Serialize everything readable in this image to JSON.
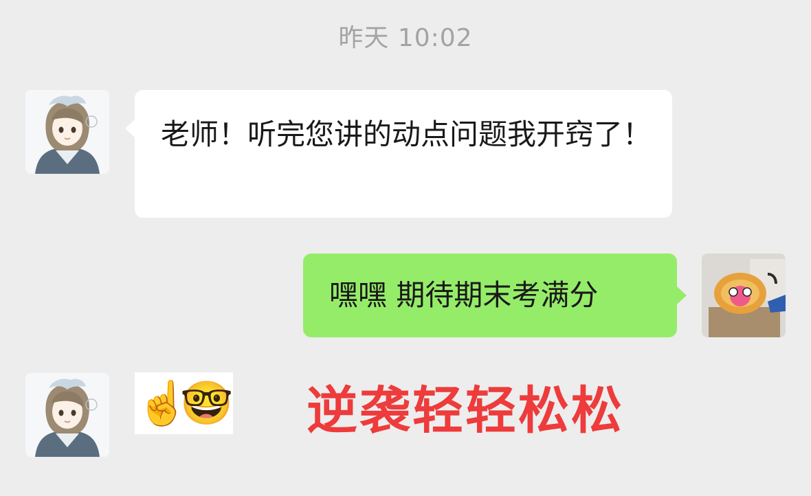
{
  "chat": {
    "timestamp": "昨天 10:02",
    "messages": [
      {
        "sender": "contact",
        "avatar": "anime-girl-avatar",
        "text": "老师！听完您讲的动点问题我开窍了！"
      },
      {
        "sender": "me",
        "avatar": "plush-toy-avatar",
        "text": "嘿嘿 期待期末考满分"
      },
      {
        "sender": "contact",
        "avatar": "anime-girl-avatar",
        "emojis": [
          "☝️",
          "🤓"
        ]
      }
    ]
  },
  "overlay": {
    "caption": "逆袭轻轻松松",
    "caption_color": "#ee3b3b"
  },
  "colors": {
    "background": "#ededed",
    "incoming_bubble": "#ffffff",
    "outgoing_bubble": "#95ec69"
  }
}
